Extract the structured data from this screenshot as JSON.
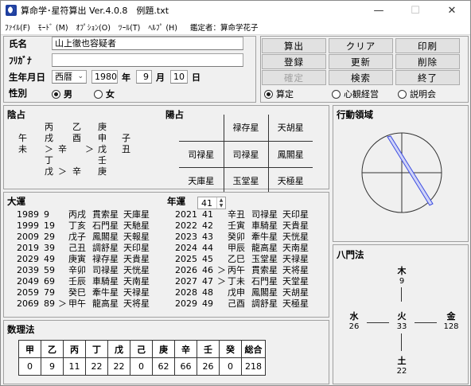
{
  "window": {
    "title": "算命学･星符算出 Ver.4.0.8　例題.txt",
    "minimize": "—",
    "maximize": "☐",
    "close": "✕"
  },
  "menu": {
    "items": [
      "ﾌｧｲﾙ(F)",
      "ﾓｰﾄﾞ (M)",
      "ｵﾌﾟｼｮﾝ(O)",
      "ﾂｰﾙ(T)",
      "ﾍﾙﾌﾟ (H)"
    ],
    "appraiser": "鑑定者：算命学花子"
  },
  "form": {
    "name_label": "氏名",
    "name_value": "山上徹也容疑者",
    "furigana_label": "ﾌﾘｶﾞﾅ",
    "furigana_value": "",
    "birth_label": "生年月日",
    "era": "西暦",
    "year": "1980",
    "year_unit": "年",
    "month": "9",
    "month_unit": "月",
    "day": "10",
    "day_unit": "日",
    "gender_label": "性別",
    "male": "男",
    "female": "女",
    "gender_selected": "男"
  },
  "buttons": {
    "calc": "算出",
    "clear": "クリア",
    "print": "印刷",
    "register": "登録",
    "update": "更新",
    "delete": "削除",
    "confirm": "確定",
    "search": "検索",
    "exit": "終了"
  },
  "modes": {
    "a": "算定",
    "b": "心観経営",
    "c": "説明会",
    "selected": "算定"
  },
  "yin": {
    "title": "陰占",
    "rows": [
      [
        "",
        "丙",
        "",
        "乙",
        "",
        "庚",
        ""
      ],
      [
        "午",
        "戌",
        "",
        "酉",
        "",
        "申",
        "子"
      ],
      [
        "未",
        "＞",
        "辛",
        "",
        "＞",
        "戊",
        "丑"
      ],
      [
        "",
        "丁",
        "",
        "",
        "",
        "壬",
        ""
      ],
      [
        "",
        "戊",
        "＞",
        "辛",
        "",
        "庚",
        ""
      ]
    ]
  },
  "yang": {
    "title": "陽占",
    "row1": [
      "",
      "禄存星",
      "天胡星"
    ],
    "row2": [
      "司禄星",
      "司禄星",
      "鳳閣星"
    ],
    "row3": [
      "天庫星",
      "玉堂星",
      "天極星"
    ]
  },
  "action": {
    "title": "行動領域"
  },
  "taiun": {
    "title": "大運",
    "rows": [
      [
        "1989",
        "9",
        "",
        "丙戌",
        "貫索星",
        "天庫星"
      ],
      [
        "1999",
        "19",
        "",
        "丁亥",
        "石門星",
        "天馳星"
      ],
      [
        "2009",
        "29",
        "",
        "戊子",
        "鳳閣星",
        "天報星"
      ],
      [
        "2019",
        "39",
        "",
        "己丑",
        "調舒星",
        "天印星"
      ],
      [
        "2029",
        "49",
        "",
        "庚寅",
        "禄存星",
        "天貴星"
      ],
      [
        "2039",
        "59",
        "",
        "辛卯",
        "司禄星",
        "天恍星"
      ],
      [
        "2049",
        "69",
        "",
        "壬辰",
        "車騎星",
        "天南星"
      ],
      [
        "2059",
        "79",
        "",
        "癸巳",
        "牽牛星",
        "天禄星"
      ],
      [
        "2069",
        "89",
        "＞",
        "甲午",
        "龍高星",
        "天将星"
      ]
    ]
  },
  "nenun": {
    "title": "年運",
    "spin_value": "41",
    "rows": [
      [
        "2021",
        "41",
        "",
        "辛丑",
        "司禄星",
        "天印星"
      ],
      [
        "2022",
        "42",
        "",
        "壬寅",
        "車騎星",
        "天貴星"
      ],
      [
        "2023",
        "43",
        "",
        "癸卯",
        "牽牛星",
        "天恍星"
      ],
      [
        "2024",
        "44",
        "",
        "甲辰",
        "龍高星",
        "天南星"
      ],
      [
        "2025",
        "45",
        "",
        "乙巳",
        "玉堂星",
        "天禄星"
      ],
      [
        "2026",
        "46",
        "＞",
        "丙午",
        "貫索星",
        "天将星"
      ],
      [
        "2027",
        "47",
        "＞",
        "丁未",
        "石門星",
        "天堂星"
      ],
      [
        "2028",
        "48",
        "",
        "戊申",
        "鳳閣星",
        "天胡星"
      ],
      [
        "2029",
        "49",
        "",
        "己酉",
        "調舒星",
        "天極星"
      ]
    ]
  },
  "suurihou": {
    "title": "数理法",
    "headers": [
      "甲",
      "乙",
      "丙",
      "丁",
      "戊",
      "己",
      "庚",
      "辛",
      "壬",
      "癸",
      "総合"
    ],
    "values": [
      "0",
      "9",
      "11",
      "22",
      "22",
      "0",
      "62",
      "66",
      "26",
      "0",
      "218"
    ]
  },
  "hachimon": {
    "title": "八門法",
    "north": {
      "name": "木",
      "value": "9"
    },
    "west": {
      "name": "水",
      "value": "26"
    },
    "center": {
      "name": "火",
      "value": "33"
    },
    "east": {
      "name": "金",
      "value": "128"
    },
    "south": {
      "name": "土",
      "value": "22"
    }
  }
}
